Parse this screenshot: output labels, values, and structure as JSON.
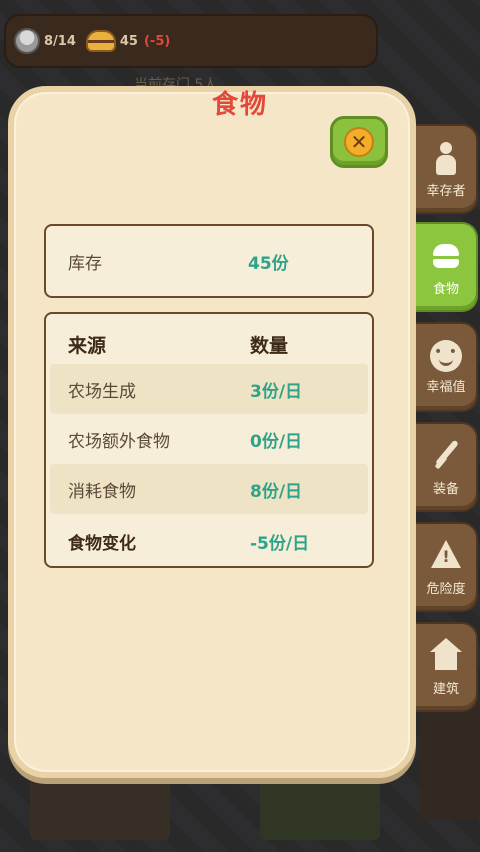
{
  "status_bar": {
    "survivors": "8/14",
    "food": "45",
    "food_change": "(-5)"
  },
  "background_text": "当前存门  5人",
  "panel": {
    "title": "食物",
    "stock": {
      "label": "库存",
      "value": "45份"
    },
    "table": {
      "header": {
        "source": "来源",
        "amount": "数量"
      },
      "rows": [
        {
          "source": "农场生成",
          "amount": "3份/日"
        },
        {
          "source": "农场额外食物",
          "amount": "0份/日"
        },
        {
          "source": "消耗食物",
          "amount": "8份/日"
        }
      ],
      "total": {
        "source": "食物变化",
        "amount": "-5份/日"
      }
    }
  },
  "tabs": [
    {
      "label": "幸存者",
      "icon": "person-icon",
      "active": false
    },
    {
      "label": "食物",
      "icon": "burger-icon",
      "active": true
    },
    {
      "label": "幸福值",
      "icon": "smile-icon",
      "active": false
    },
    {
      "label": "装备",
      "icon": "sword-icon",
      "active": false
    },
    {
      "label": "危险度",
      "icon": "warning-icon",
      "active": false
    },
    {
      "label": "建筑",
      "icon": "house-icon",
      "active": false
    }
  ],
  "colors": {
    "title": "#e3493a",
    "value_green": "#2fa38a",
    "panel_bg": "#f5e6c8",
    "tab_active": "#8cc63f",
    "tab_inactive": "#7a5a3a"
  }
}
